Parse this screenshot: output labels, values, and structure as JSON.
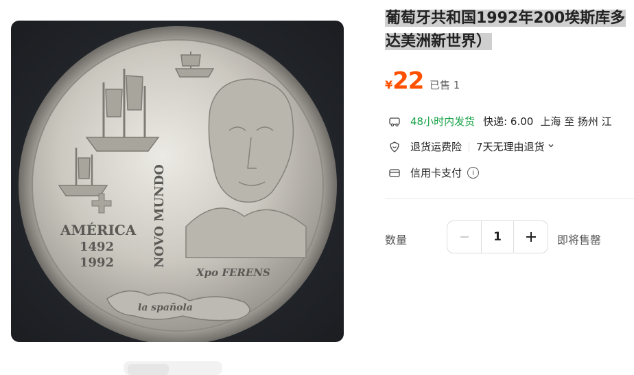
{
  "product": {
    "title_line1": "葡萄牙共和国1992年200埃斯库多",
    "title_line2": "达美洲新世界）",
    "price_symbol": "¥",
    "price": "22",
    "sold": "已售 1",
    "accent_color": "#ff5000"
  },
  "shipping": {
    "icon": "delivery-van-icon",
    "highlight": "48小时内发货",
    "fee": "快递: 6.00",
    "route": "上海 至 扬州 江"
  },
  "returns": {
    "icon": "shield-heart-icon",
    "insurance": "退货运费险",
    "policy": "7天无理由退货",
    "policy_icon": "chevron-down-icon"
  },
  "payment": {
    "icon": "credit-card-icon",
    "text": "信用卡支付",
    "info_icon": "info-icon"
  },
  "quantity": {
    "label": "数量",
    "value": "1",
    "minus_icon": "minus-icon",
    "plus_icon": "plus-icon",
    "stock_note": "即将售罄"
  },
  "image": {
    "alt_icon": "coin-photo",
    "coin_text": {
      "america": "AMÉRICA",
      "year1": "1492",
      "year2": "1992",
      "novo_mundo": "NOVO MUNDO",
      "ferens": "Xpo FERENS",
      "espanola": "la spañola"
    }
  }
}
